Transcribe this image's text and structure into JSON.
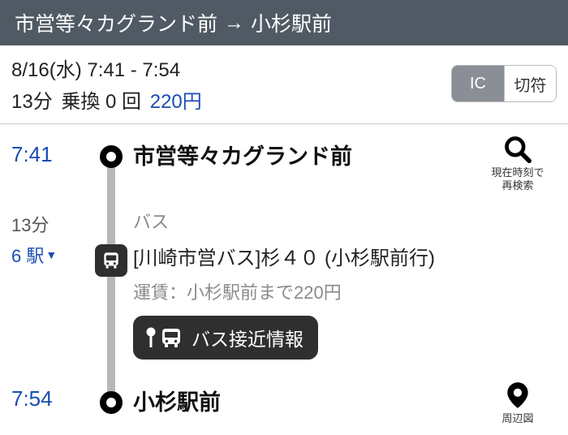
{
  "header": {
    "from": "市営等々カグランド前",
    "arrow": "→",
    "to": "小杉駅前"
  },
  "summary": {
    "date_times": "8/16(水)  7:41 -  7:54",
    "duration": "13分",
    "transfers": "乗換 0 回",
    "fare": "220円"
  },
  "toggle": {
    "ic": "IC",
    "ticket": "切符"
  },
  "route": {
    "start": {
      "time": "7:41",
      "station": "市営等々カグランド前"
    },
    "segment": {
      "duration": "13分",
      "stops": "6 駅",
      "mode": "バス",
      "line": "[川崎市営バス]杉４０ (小杉駅前行)",
      "fare_text": "運賃：小杉駅前まで220円",
      "approach_button": "バス接近情報"
    },
    "end": {
      "time": "7:54",
      "station": "小杉駅前"
    }
  },
  "actions": {
    "research": "現在時刻で\n再検索",
    "map": "周辺図"
  }
}
